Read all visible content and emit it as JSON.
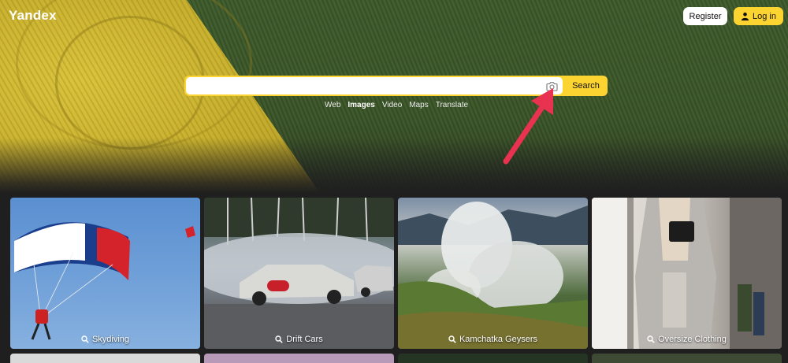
{
  "app": {
    "logo": "Yandex"
  },
  "header": {
    "register_label": "Register",
    "login_label": "Log in"
  },
  "search": {
    "placeholder": "",
    "value": "",
    "button_label": "Search"
  },
  "nav": {
    "items": [
      {
        "label": "Web",
        "active": false
      },
      {
        "label": "Images",
        "active": true
      },
      {
        "label": "Video",
        "active": false
      },
      {
        "label": "Maps",
        "active": false
      },
      {
        "label": "Translate",
        "active": false
      }
    ]
  },
  "cards": [
    {
      "caption": "Skydiving"
    },
    {
      "caption": "Drift Cars"
    },
    {
      "caption": "Kamchatka Geysers"
    },
    {
      "caption": "Oversize Clothing"
    }
  ],
  "colors": {
    "accent": "#fcd432",
    "arrow": "#e8324f",
    "background": "#1f1f1f"
  }
}
